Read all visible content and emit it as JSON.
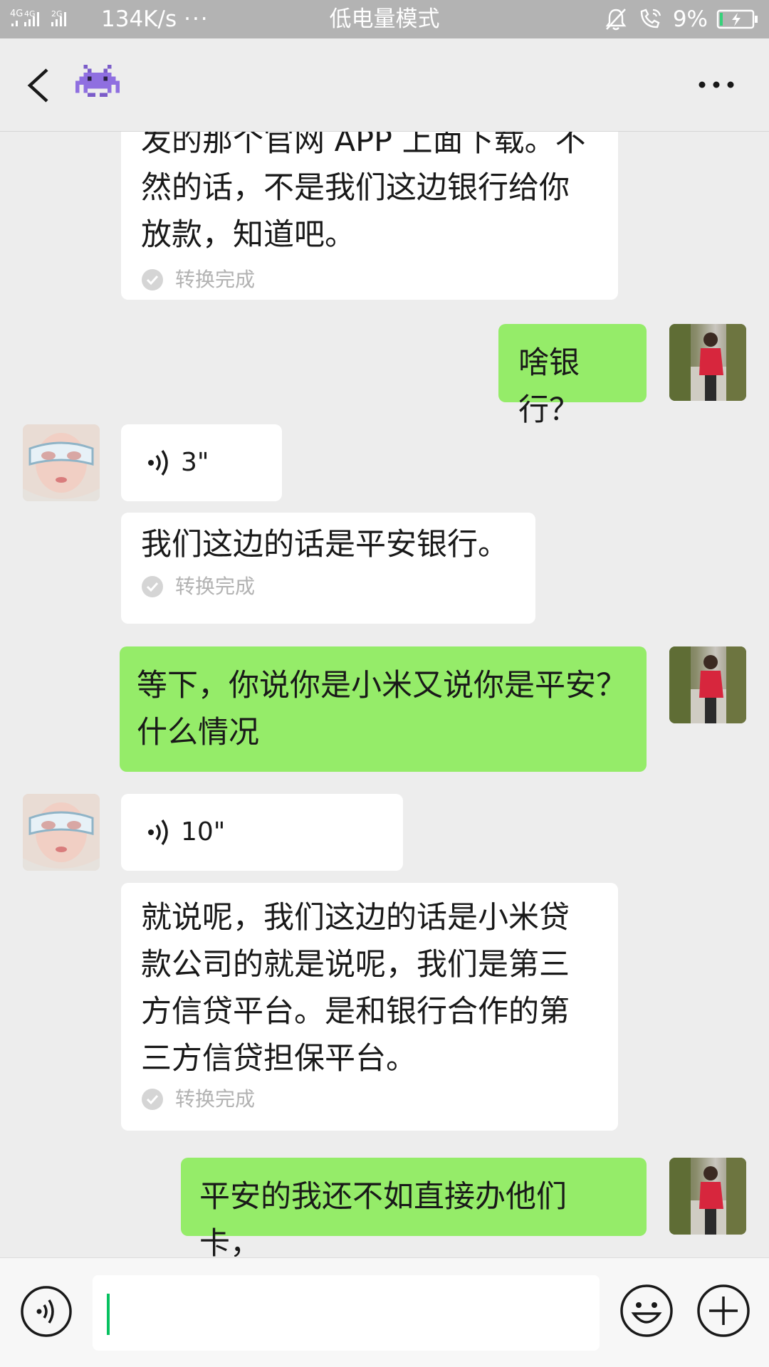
{
  "status_bar": {
    "network_icon": "signal-4g-4g-2g-icon",
    "speed": "134K/s",
    "more": "···",
    "mode": "低电量模式",
    "mute_icon": "bell-off-icon",
    "call_icon": "wifi-call-icon",
    "battery_percent": "9%",
    "battery_icon": "battery-charging-icon",
    "battery_level": 0.09
  },
  "header": {
    "back_icon": "chevron-left-icon",
    "avatar_icon": "pixel-alien-avatar",
    "more_icon": "more-dots-icon"
  },
  "messages": [
    {
      "side": "left",
      "type": "voice-text",
      "text_lines": [
        "发的那个官网 APP 上面下载。不",
        "然的话，不是我们这边银行给你",
        "放款，知道吧。"
      ],
      "status": "转换完成"
    },
    {
      "side": "right",
      "type": "text",
      "text": "啥银行？"
    },
    {
      "side": "left",
      "type": "voice",
      "duration": "3\""
    },
    {
      "side": "left",
      "type": "voice-text",
      "text_lines": [
        "我们这边的话是平安银行。"
      ],
      "status": "转换完成"
    },
    {
      "side": "right",
      "type": "text",
      "text_lines": [
        "等下，你说你是小米又说你是平安？",
        "什么情况"
      ]
    },
    {
      "side": "left",
      "type": "voice",
      "duration": "10\""
    },
    {
      "side": "left",
      "type": "voice-text",
      "text_lines": [
        "就说呢，我们这边的话是小米贷",
        "款公司的就是说呢，我们是第三",
        "方信贷平台。是和银行合作的第",
        "三方信贷担保平台。"
      ],
      "status": "转换完成"
    },
    {
      "side": "right",
      "type": "text",
      "text": "平安的我还不如直接办他们卡，"
    }
  ],
  "input_bar": {
    "voice_icon": "voice-wave-icon",
    "input_value": "",
    "emoji_icon": "smiley-icon",
    "plus_icon": "plus-circle-icon"
  },
  "colors": {
    "status_bar_bg": "#b3b3b3",
    "chat_bg": "#ededed",
    "sent_bubble": "#95ec69",
    "received_bubble": "#ffffff",
    "cursor": "#07c160"
  }
}
